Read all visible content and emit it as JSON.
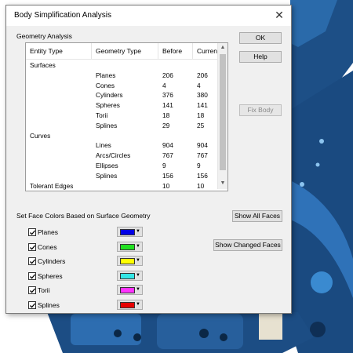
{
  "dialog": {
    "title": "Body Simplification Analysis",
    "close_label": "✕",
    "section_geometry": "Geometry Analysis",
    "section_colors": "Set Face Colors Based on Surface Geometry"
  },
  "buttons": {
    "ok": "OK",
    "help": "Help",
    "fix_body": "Fix Body",
    "show_all_faces": "Show All Faces",
    "show_changed_faces": "Show Changed Faces"
  },
  "table": {
    "headers": [
      "Entity Type",
      "Geometry Type",
      "Before",
      "Curren"
    ],
    "rows": [
      [
        "Surfaces",
        "",
        "",
        ""
      ],
      [
        "",
        "Planes",
        "206",
        "206"
      ],
      [
        "",
        "Cones",
        "4",
        "4"
      ],
      [
        "",
        "Cylinders",
        "376",
        "380"
      ],
      [
        "",
        "Spheres",
        "141",
        "141"
      ],
      [
        "",
        "Torii",
        "18",
        "18"
      ],
      [
        "",
        "Splines",
        "29",
        "25"
      ],
      [
        "Curves",
        "",
        "",
        ""
      ],
      [
        "",
        "Lines",
        "904",
        "904"
      ],
      [
        "",
        "Arcs/Circles",
        "767",
        "767"
      ],
      [
        "",
        "Ellipses",
        "9",
        "9"
      ],
      [
        "",
        "Splines",
        "156",
        "156"
      ],
      [
        "Tolerant Edges",
        "",
        "10",
        "10"
      ]
    ]
  },
  "face_colors": [
    {
      "label": "Planes",
      "checked": true,
      "color": "#0000e6"
    },
    {
      "label": "Cones",
      "checked": true,
      "color": "#22e022"
    },
    {
      "label": "Cylinders",
      "checked": true,
      "color": "#ffff00"
    },
    {
      "label": "Spheres",
      "checked": true,
      "color": "#33e6e6"
    },
    {
      "label": "Torii",
      "checked": true,
      "color": "#ff33ff"
    },
    {
      "label": "Splines",
      "checked": true,
      "color": "#e60000"
    }
  ],
  "colors": {
    "model_blue": "#1a4a80",
    "model_light": "#2f72b8",
    "cad_background": "#ffffff"
  }
}
